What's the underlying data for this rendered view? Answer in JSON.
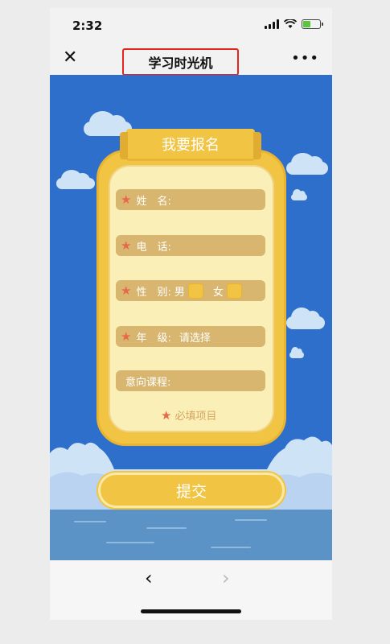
{
  "status": {
    "time": "2:32"
  },
  "navbar": {
    "title": "学习时光机",
    "close_icon": "close-icon",
    "more_icon": "more-icon"
  },
  "form": {
    "heading": "我要报名",
    "fields": [
      {
        "label": "姓　名:",
        "required": true
      },
      {
        "label": "电　话:",
        "required": true
      },
      {
        "label": "性　别:",
        "required": true,
        "options": [
          "男",
          "女"
        ]
      },
      {
        "label": "年　级:",
        "required": true,
        "placeholder": "请选择"
      },
      {
        "label": "意向课程:",
        "required": false
      }
    ],
    "required_note": "必填项目",
    "submit_label": "提交"
  },
  "colors": {
    "sky": "#2f6fcc",
    "card": "#f2c443",
    "field": "#d8b66f",
    "star": "#e7684b"
  }
}
